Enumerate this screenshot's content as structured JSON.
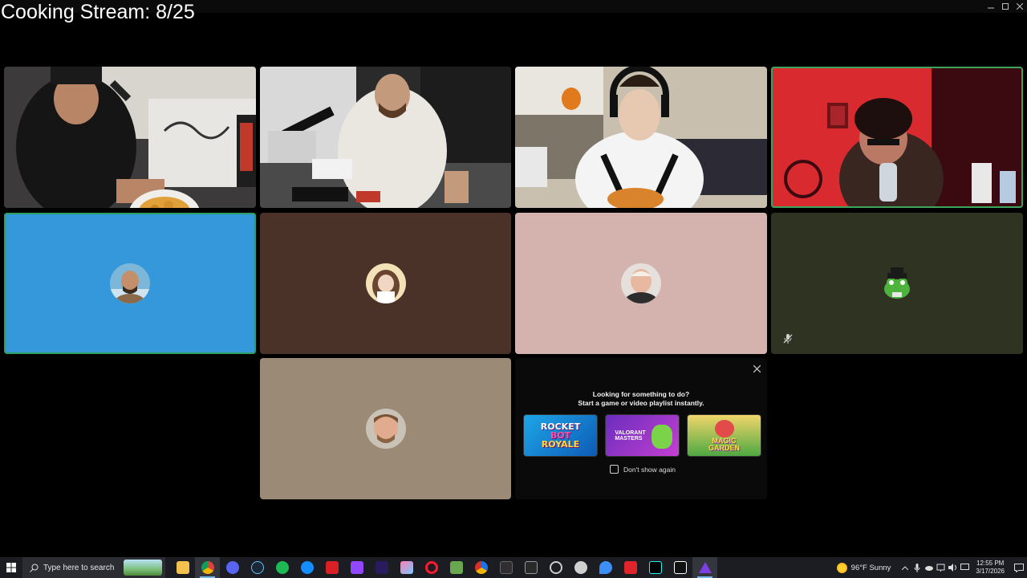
{
  "window": {
    "title": "Cooking Stream: 8/25",
    "controls": [
      "minimize",
      "maximize",
      "close"
    ]
  },
  "tiles": [
    {
      "id": "cam-1",
      "type": "camera",
      "label": "Streamer holding bowl of nuggets"
    },
    {
      "id": "cam-2",
      "type": "camera",
      "label": "Person in white tee at desk"
    },
    {
      "id": "cam-3",
      "type": "camera",
      "label": "Person with headphones eating"
    },
    {
      "id": "cam-4",
      "type": "camera",
      "label": "Person in red-lit room drinking water",
      "speaking": true
    },
    {
      "id": "user-5",
      "type": "avatar",
      "bg": "#3498db",
      "selected": true
    },
    {
      "id": "user-6",
      "type": "avatar",
      "bg": "#4a3228"
    },
    {
      "id": "user-7",
      "type": "avatar",
      "bg": "#d4b2ae"
    },
    {
      "id": "user-8",
      "type": "avatar",
      "bg": "#2f3422",
      "muted": true
    },
    {
      "id": "user-9",
      "type": "avatar",
      "bg": "#9b8a75"
    }
  ],
  "activities": {
    "heading_line1": "Looking for something to do?",
    "heading_line2": "Start a game or video playlist instantly.",
    "games": [
      {
        "name": "Rocket Bot Royale",
        "lines": [
          "ROCKET",
          "BOT",
          "ROYALE"
        ]
      },
      {
        "name": "Valorant Masters",
        "lines": [
          "VALORANT",
          "MASTERS"
        ]
      },
      {
        "name": "Magic Garden",
        "lines": [
          "MAGIC",
          "GARDEN"
        ]
      }
    ],
    "dont_show_label": "Don't show again"
  },
  "taskbar": {
    "search_placeholder": "Type here to search",
    "weather": "96°F  Sunny",
    "time": "12:55 PM",
    "date": "3/17/2026",
    "apps": [
      "file-explorer",
      "chrome",
      "discord",
      "steam",
      "spotify",
      "battlenet",
      "adobe",
      "twitch",
      "premiere",
      "photos",
      "opera",
      "minecraft",
      "chrome-alt",
      "obs",
      "epic-games",
      "settings",
      "xbox",
      "app-blue",
      "recorder",
      "tiktok",
      "capcut",
      "app-purple"
    ]
  },
  "colors": {
    "speaking_outline": "#3ba55c",
    "taskbar_bg": "#1b1d23"
  }
}
